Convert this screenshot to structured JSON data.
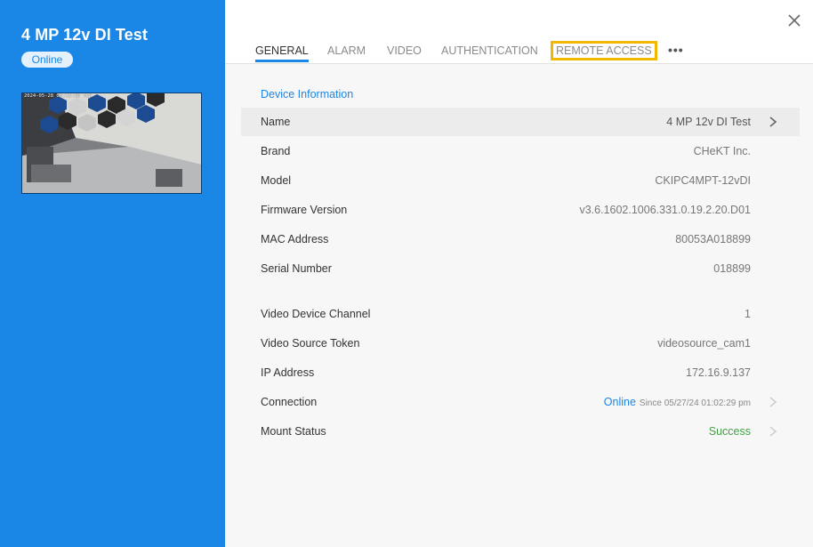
{
  "camera": {
    "title": "4 MP 12v DI Test",
    "status": "Online",
    "timestamp_overlay": "2024-05-28 08:43:20 Tue"
  },
  "tabs": [
    {
      "label": "GENERAL",
      "active": true
    },
    {
      "label": "ALARM"
    },
    {
      "label": "VIDEO"
    },
    {
      "label": "AUTHENTICATION"
    },
    {
      "label": "REMOTE ACCESS",
      "highlighted": true
    }
  ],
  "more_label": "•••",
  "section": {
    "title": "Device Information"
  },
  "rows": {
    "name": {
      "label": "Name",
      "value": "4 MP 12v DI Test"
    },
    "brand": {
      "label": "Brand",
      "value": "CHeKT Inc."
    },
    "model": {
      "label": "Model",
      "value": "CKIPC4MPT-12vDI"
    },
    "firmware": {
      "label": "Firmware Version",
      "value": "v3.6.1602.1006.331.0.19.2.20.D01"
    },
    "mac": {
      "label": "MAC Address",
      "value": "80053A018899"
    },
    "serial": {
      "label": "Serial Number",
      "value": "018899"
    },
    "channel": {
      "label": "Video Device Channel",
      "value": "1"
    },
    "source_token": {
      "label": "Video Source Token",
      "value": "videosource_cam1"
    },
    "ip": {
      "label": "IP Address",
      "value": "172.16.9.137"
    },
    "connection": {
      "label": "Connection",
      "status": "Online",
      "since": "Since 05/27/24 01:02:29 pm"
    },
    "mount": {
      "label": "Mount Status",
      "value": "Success"
    }
  },
  "colors": {
    "sidebar": "#1a86e6",
    "accent": "#1a86e6",
    "highlight_outline": "#f0b800",
    "success": "#43a047"
  },
  "icons": {
    "close": "close-icon",
    "chevron": "chevron-right-icon",
    "more": "more-horizontal-icon"
  }
}
